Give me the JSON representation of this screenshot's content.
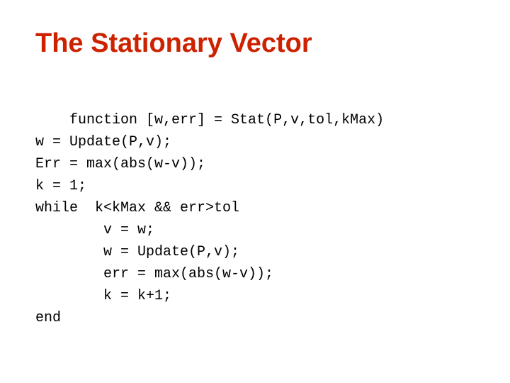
{
  "slide": {
    "title": "The Stationary Vector",
    "code": {
      "lines": [
        "function [w,err] = Stat(P,v,tol,kMax)",
        "w = Update(P,v);",
        "Err = max(abs(w-v));",
        "k = 1;",
        "while  k<kMax && err>tol",
        "        v = w;",
        "        w = Update(P,v);",
        "        err = max(abs(w-v));",
        "        k = k+1;",
        "end"
      ]
    }
  }
}
